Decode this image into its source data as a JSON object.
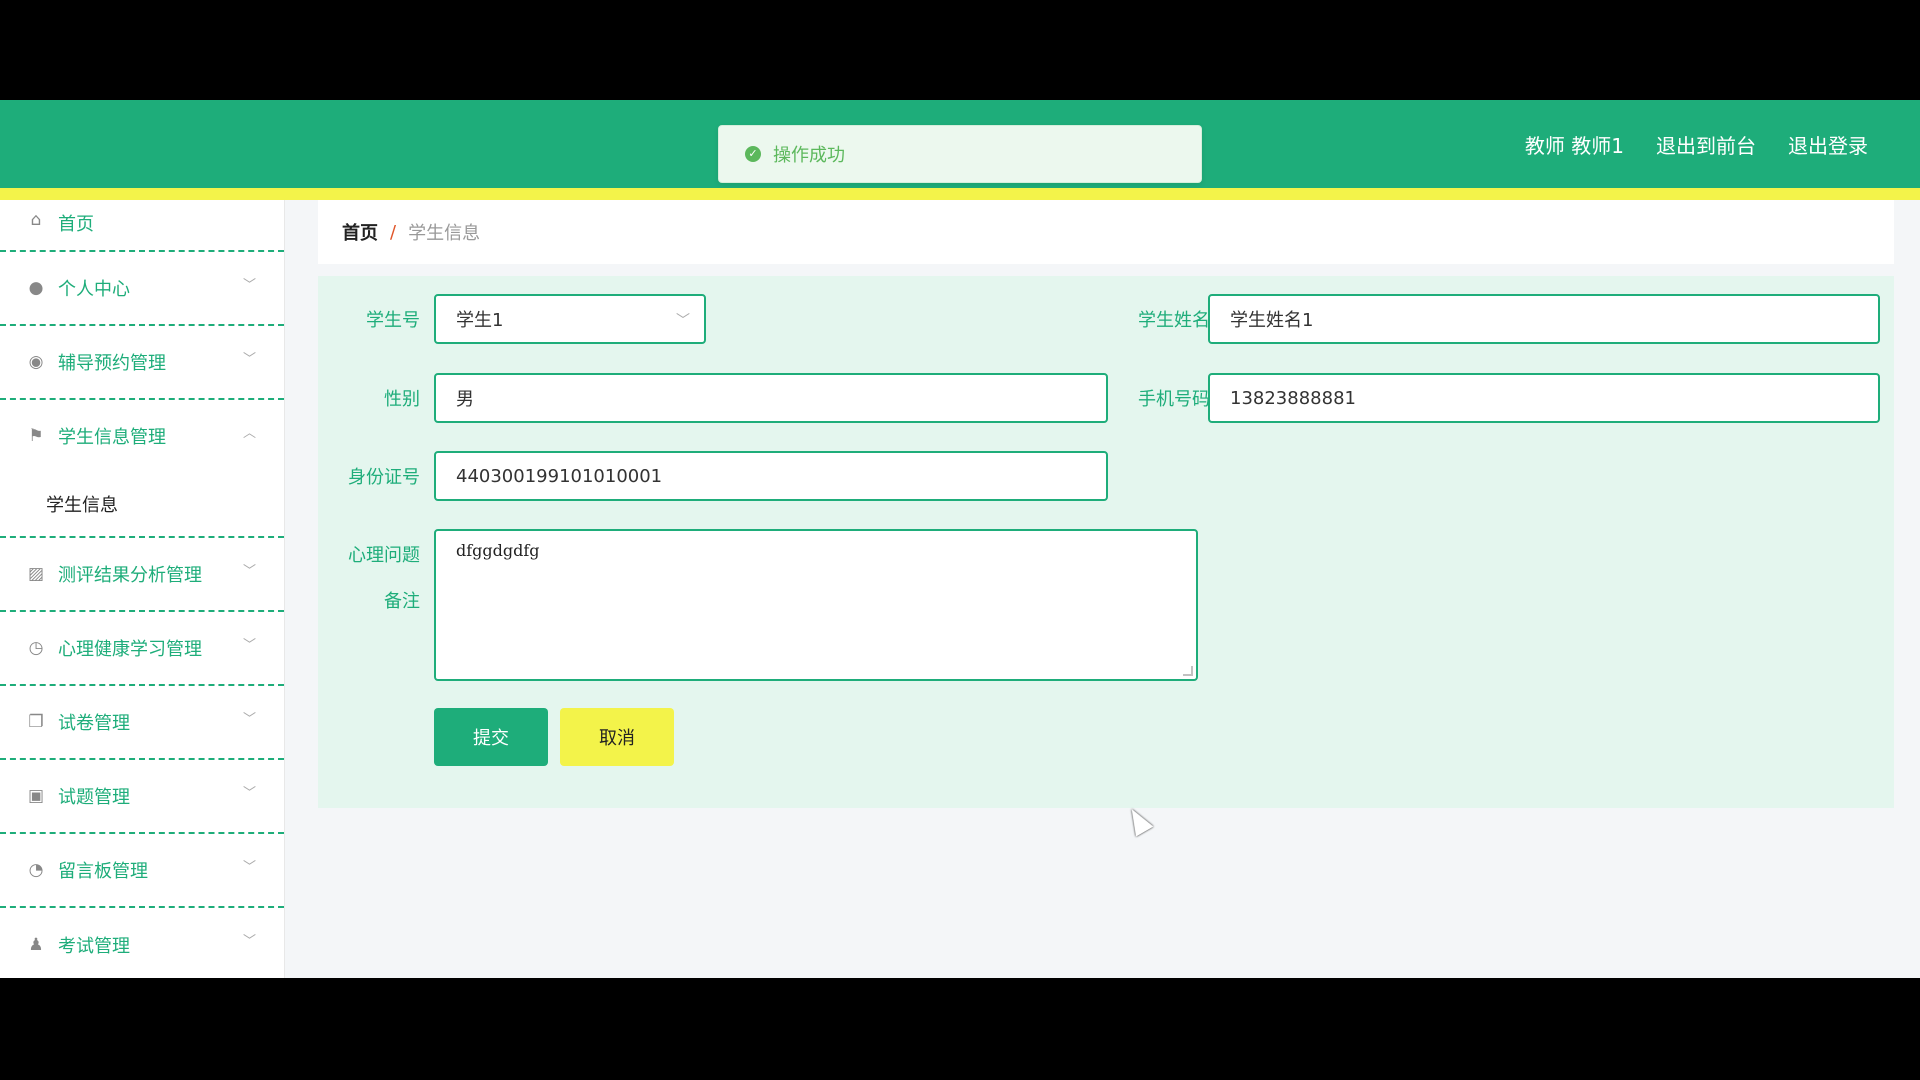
{
  "header": {
    "toast_message": "操作成功",
    "user_label": "教师 教师1",
    "back_to_front": "退出到前台",
    "logout": "退出登录"
  },
  "colors": {
    "primary": "#1ead7a",
    "accent_yellow": "#f3f34a",
    "toast_green": "#5cb85c"
  },
  "sidebar": {
    "items": [
      {
        "label": "首页",
        "icon": "home-icon"
      },
      {
        "label": "个人中心",
        "icon": "user-icon"
      },
      {
        "label": "辅导预约管理",
        "icon": "pin-icon"
      },
      {
        "label": "学生信息管理",
        "icon": "flag-icon",
        "expanded": true,
        "children": [
          {
            "label": "学生信息"
          }
        ]
      },
      {
        "label": "测评结果分析管理",
        "icon": "chart-icon"
      },
      {
        "label": "心理健康学习管理",
        "icon": "compass-icon"
      },
      {
        "label": "试卷管理",
        "icon": "copy-icon"
      },
      {
        "label": "试题管理",
        "icon": "clipboard-icon"
      },
      {
        "label": "留言板管理",
        "icon": "gauge-icon"
      },
      {
        "label": "考试管理",
        "icon": "person-icon"
      }
    ]
  },
  "breadcrumb": {
    "home": "首页",
    "separator": "/",
    "current": "学生信息"
  },
  "form": {
    "student_no_label": "学生号",
    "student_no_value": "学生1",
    "student_name_label": "学生姓名",
    "student_name_value": "学生姓名1",
    "gender_label": "性别",
    "gender_value": "男",
    "phone_label": "手机号码",
    "phone_value": "13823888881",
    "id_card_label": "身份证号",
    "id_card_value": "440300199101010001",
    "issue_label_line1": "心理问题",
    "issue_label_line2": "备注",
    "issue_value": "dfggdgdfg",
    "submit_label": "提交",
    "cancel_label": "取消"
  }
}
